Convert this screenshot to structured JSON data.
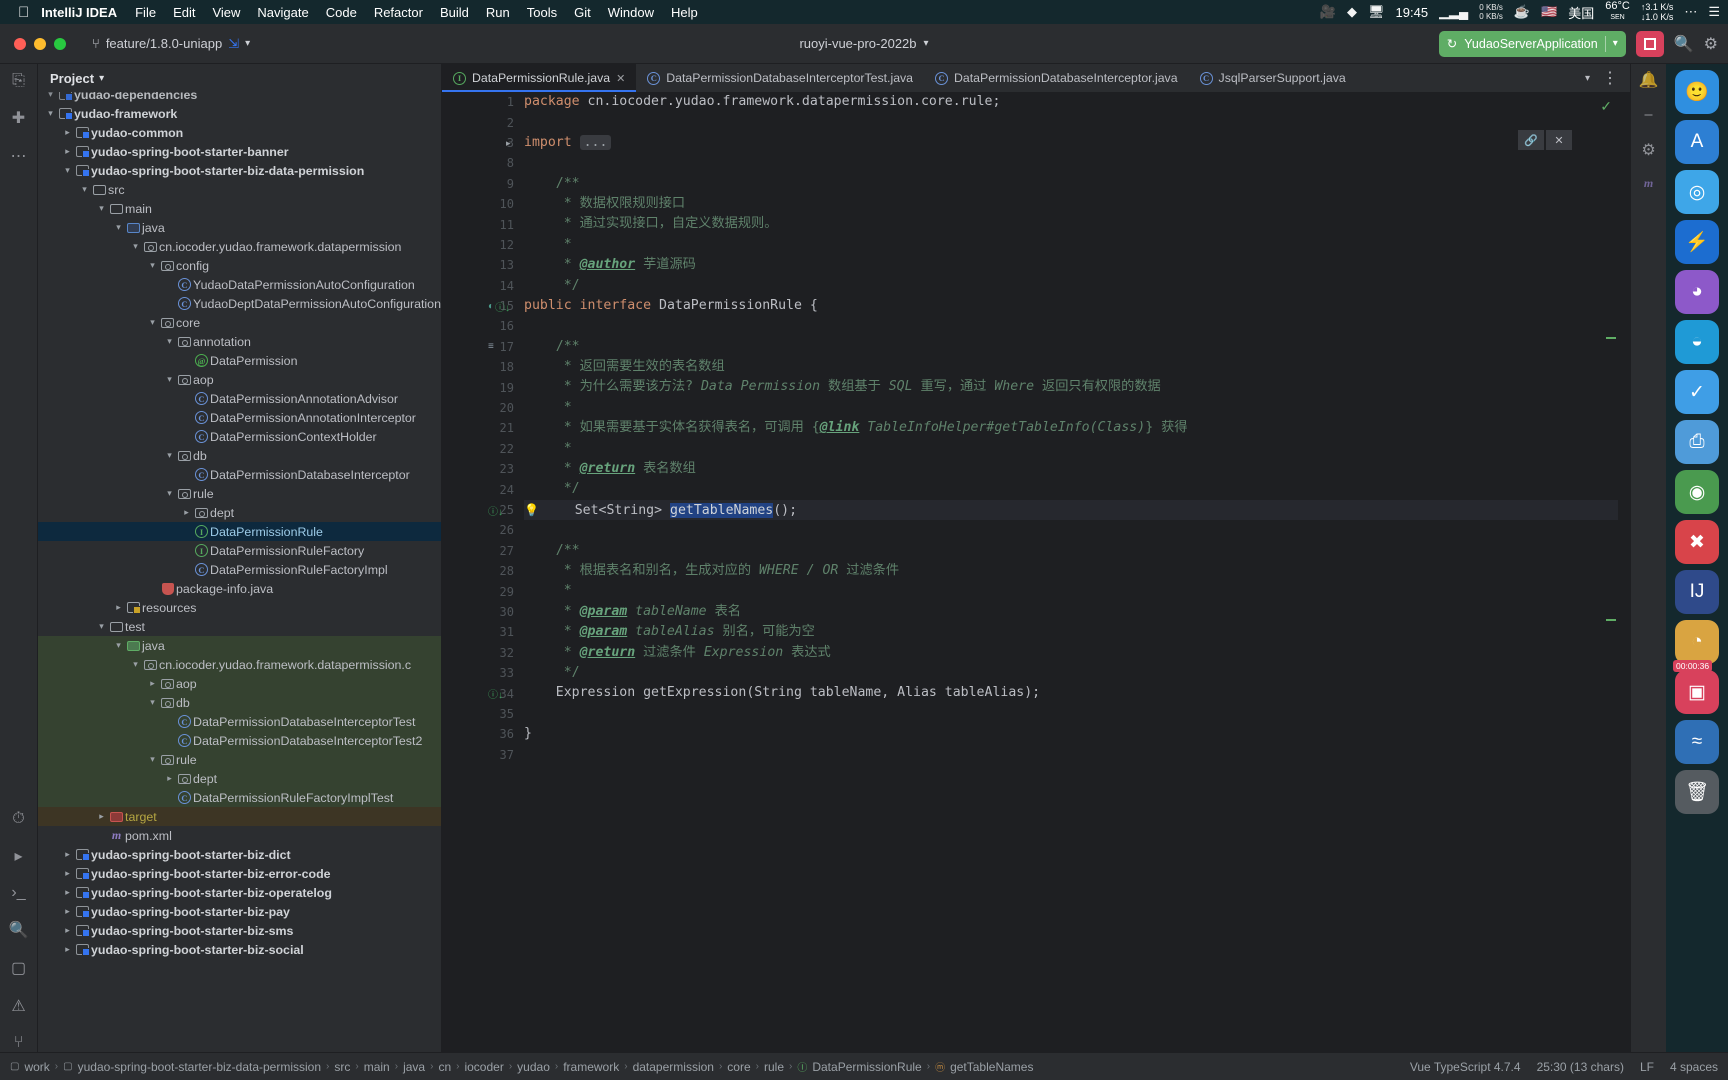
{
  "macbar": {
    "apple_icon": "apple-icon",
    "app_name": "IntelliJ IDEA",
    "menus": [
      "File",
      "Edit",
      "View",
      "Navigate",
      "Code",
      "Refactor",
      "Build",
      "Run",
      "Tools",
      "Git",
      "Window",
      "Help"
    ],
    "status": {
      "clock": "19:45",
      "net_up": "0 KB/s",
      "net_down": "0 KB/s",
      "input_source": "美国",
      "temperature": "66°C",
      "temperature_sub": "SEN",
      "speed_up": "3.1 K/s",
      "speed_down": "1.0 K/s"
    }
  },
  "titlebar": {
    "branch": "feature/1.8.0-uniapp",
    "project": "ruoyi-vue-pro-2022b",
    "run_config": "YudaoServerApplication",
    "stop_label": "stop-icon"
  },
  "project_panel": {
    "title": "Project",
    "tree": [
      {
        "depth": 1,
        "label": "yudao-dependencies",
        "arrow": "down",
        "icon": "module",
        "bold": true,
        "state": "clipped"
      },
      {
        "depth": 1,
        "label": "yudao-framework",
        "arrow": "down",
        "icon": "module",
        "bold": true
      },
      {
        "depth": 2,
        "label": "yudao-common",
        "arrow": "right",
        "icon": "module",
        "bold": true
      },
      {
        "depth": 2,
        "label": "yudao-spring-boot-starter-banner",
        "arrow": "right",
        "icon": "module",
        "bold": true
      },
      {
        "depth": 2,
        "label": "yudao-spring-boot-starter-biz-data-permission",
        "arrow": "down",
        "icon": "module",
        "bold": true
      },
      {
        "depth": 3,
        "label": "src",
        "arrow": "down",
        "icon": "folder"
      },
      {
        "depth": 4,
        "label": "main",
        "arrow": "down",
        "icon": "folder"
      },
      {
        "depth": 5,
        "label": "java",
        "arrow": "down",
        "icon": "folder-blue"
      },
      {
        "depth": 6,
        "label": "cn.iocoder.yudao.framework.datapermission",
        "arrow": "down",
        "icon": "package"
      },
      {
        "depth": 7,
        "label": "config",
        "arrow": "down",
        "icon": "package"
      },
      {
        "depth": 8,
        "label": "YudaoDataPermissionAutoConfiguration",
        "arrow": "none",
        "icon": "class"
      },
      {
        "depth": 8,
        "label": "YudaoDeptDataPermissionAutoConfiguration",
        "arrow": "none",
        "icon": "class"
      },
      {
        "depth": 7,
        "label": "core",
        "arrow": "down",
        "icon": "package"
      },
      {
        "depth": 8,
        "label": "annotation",
        "arrow": "down",
        "icon": "package"
      },
      {
        "depth": 9,
        "label": "DataPermission",
        "arrow": "none",
        "icon": "annotation"
      },
      {
        "depth": 8,
        "label": "aop",
        "arrow": "down",
        "icon": "package"
      },
      {
        "depth": 9,
        "label": "DataPermissionAnnotationAdvisor",
        "arrow": "none",
        "icon": "class"
      },
      {
        "depth": 9,
        "label": "DataPermissionAnnotationInterceptor",
        "arrow": "none",
        "icon": "class"
      },
      {
        "depth": 9,
        "label": "DataPermissionContextHolder",
        "arrow": "none",
        "icon": "class"
      },
      {
        "depth": 8,
        "label": "db",
        "arrow": "down",
        "icon": "package"
      },
      {
        "depth": 9,
        "label": "DataPermissionDatabaseInterceptor",
        "arrow": "none",
        "icon": "class"
      },
      {
        "depth": 8,
        "label": "rule",
        "arrow": "down",
        "icon": "package"
      },
      {
        "depth": 9,
        "label": "dept",
        "arrow": "right",
        "icon": "package"
      },
      {
        "depth": 9,
        "label": "DataPermissionRule",
        "arrow": "none",
        "icon": "interface",
        "selected": true
      },
      {
        "depth": 9,
        "label": "DataPermissionRuleFactory",
        "arrow": "none",
        "icon": "interface"
      },
      {
        "depth": 9,
        "label": "DataPermissionRuleFactoryImpl",
        "arrow": "none",
        "icon": "class"
      },
      {
        "depth": 7,
        "label": "package-info.java",
        "arrow": "none",
        "icon": "java"
      },
      {
        "depth": 5,
        "label": "resources",
        "arrow": "right",
        "icon": "resources"
      },
      {
        "depth": 4,
        "label": "test",
        "arrow": "down",
        "icon": "folder"
      },
      {
        "depth": 5,
        "label": "java",
        "arrow": "down",
        "icon": "folder-green",
        "testscope": true
      },
      {
        "depth": 6,
        "label": "cn.iocoder.yudao.framework.datapermission.c",
        "arrow": "down",
        "icon": "package",
        "testscope": true
      },
      {
        "depth": 7,
        "label": "aop",
        "arrow": "right",
        "icon": "package",
        "testscope": true
      },
      {
        "depth": 7,
        "label": "db",
        "arrow": "down",
        "icon": "package",
        "testscope": true
      },
      {
        "depth": 8,
        "label": "DataPermissionDatabaseInterceptorTest",
        "arrow": "none",
        "icon": "class",
        "testscope": true
      },
      {
        "depth": 8,
        "label": "DataPermissionDatabaseInterceptorTest2",
        "arrow": "none",
        "icon": "class",
        "testscope": true
      },
      {
        "depth": 7,
        "label": "rule",
        "arrow": "down",
        "icon": "package",
        "testscope": true
      },
      {
        "depth": 8,
        "label": "dept",
        "arrow": "right",
        "icon": "package",
        "testscope": true
      },
      {
        "depth": 8,
        "label": "DataPermissionRuleFactoryImplTest",
        "arrow": "none",
        "icon": "class",
        "testscope": true
      },
      {
        "depth": 4,
        "label": "target",
        "arrow": "right",
        "icon": "folder-red",
        "target": true
      },
      {
        "depth": 4,
        "label": "pom.xml",
        "arrow": "none",
        "icon": "maven"
      },
      {
        "depth": 2,
        "label": "yudao-spring-boot-starter-biz-dict",
        "arrow": "right",
        "icon": "module",
        "bold": true
      },
      {
        "depth": 2,
        "label": "yudao-spring-boot-starter-biz-error-code",
        "arrow": "right",
        "icon": "module",
        "bold": true
      },
      {
        "depth": 2,
        "label": "yudao-spring-boot-starter-biz-operatelog",
        "arrow": "right",
        "icon": "module",
        "bold": true
      },
      {
        "depth": 2,
        "label": "yudao-spring-boot-starter-biz-pay",
        "arrow": "right",
        "icon": "module",
        "bold": true
      },
      {
        "depth": 2,
        "label": "yudao-spring-boot-starter-biz-sms",
        "arrow": "right",
        "icon": "module",
        "bold": true
      },
      {
        "depth": 2,
        "label": "yudao-spring-boot-starter-biz-social",
        "arrow": "right",
        "icon": "module",
        "bold": true
      }
    ]
  },
  "editor": {
    "tabs": [
      {
        "label": "DataPermissionRule.java",
        "icon": "interface",
        "active": true,
        "closable": true
      },
      {
        "label": "DataPermissionDatabaseInterceptorTest.java",
        "icon": "class",
        "active": false
      },
      {
        "label": "DataPermissionDatabaseInterceptor.java",
        "icon": "class",
        "active": false
      },
      {
        "label": "JsqlParserSupport.java",
        "icon": "class",
        "active": false
      }
    ],
    "lines": [
      {
        "num": "1",
        "html": "<span class=\"kw\">package</span> <span class=\"plain\">cn.iocoder.yudao.framework.datapermission.core.rule;</span>"
      },
      {
        "num": "2",
        "html": ""
      },
      {
        "num": "3",
        "html": "<span class=\"kw\">import</span> <span class=\"import-fold\">...</span>",
        "fold": true
      },
      {
        "num": "8",
        "html": ""
      },
      {
        "num": "9",
        "html": "<span class=\"cmt\">    /**</span>"
      },
      {
        "num": "10",
        "html": "<span class=\"cmt\">     * 数据权限规则接口</span>"
      },
      {
        "num": "11",
        "html": "<span class=\"cmt\">     * 通过实现接口，自定义数据规则。</span>"
      },
      {
        "num": "12",
        "html": "<span class=\"cmt\">     *</span>"
      },
      {
        "num": "13",
        "html": "<span class=\"cmt\">     * </span><span class=\"doctag\">@author</span><span class=\"cmt\"> 芋道源码</span>"
      },
      {
        "num": "14",
        "html": "<span class=\"cmt\">     */</span>"
      },
      {
        "num": "15",
        "html": "<span class=\"kw\">public interface</span> <span class=\"plain\">DataPermissionRule {</span>",
        "gutter_icons": [
          "impl-icon",
          "override-icon"
        ]
      },
      {
        "num": "16",
        "html": ""
      },
      {
        "num": "17",
        "html": "<span class=\"cmt\">    /**</span>",
        "gutter_icons": [
          "doc-icon"
        ]
      },
      {
        "num": "18",
        "html": "<span class=\"cmt\">     * 返回需要生效的表名数组</span>"
      },
      {
        "num": "19",
        "html": "<span class=\"cmt\">     * 为什么需要该方法? </span><span class=\"cmtem\">Data Permission</span><span class=\"cmt\"> 数组基于 </span><span class=\"cmtem\">SQL</span><span class=\"cmt\"> 重写，通过 </span><span class=\"cmtem\">Where</span><span class=\"cmt\"> 返回只有权限的数据</span>"
      },
      {
        "num": "20",
        "html": "<span class=\"cmt\">     *</span>"
      },
      {
        "num": "21",
        "html": "<span class=\"cmt\">     * 如果需要基于实体名获得表名，可调用 {</span><span class=\"doctag\">@link</span><span class=\"cmtem\"> TableInfoHelper#getTableInfo(Class)</span><span class=\"cmt\">} 获得</span>"
      },
      {
        "num": "22",
        "html": "<span class=\"cmt\">     *</span>"
      },
      {
        "num": "23",
        "html": "<span class=\"cmt\">     * </span><span class=\"doctag\">@return</span><span class=\"cmt\"> 表名数组</span>"
      },
      {
        "num": "24",
        "html": "<span class=\"cmt\">     */</span>"
      },
      {
        "num": "25",
        "html": "<span class=\"plain\">    Set&lt;String&gt; </span><span class=\"sel-tok\">getTableNames</span><span class=\"plain\">();</span>",
        "gutter_icons": [
          "override-icon"
        ],
        "bulb": true,
        "current": true
      },
      {
        "num": "26",
        "html": ""
      },
      {
        "num": "27",
        "html": "<span class=\"cmt\">    /**</span>"
      },
      {
        "num": "28",
        "html": "<span class=\"cmt\">     * 根据表名和别名，生成对应的 </span><span class=\"cmtem\">WHERE / OR</span><span class=\"cmt\"> 过滤条件</span>"
      },
      {
        "num": "29",
        "html": "<span class=\"cmt\">     *</span>"
      },
      {
        "num": "30",
        "html": "<span class=\"cmt\">     * </span><span class=\"doctag\">@param</span><span class=\"cmtem\"> tableName</span><span class=\"cmt\"> 表名</span>"
      },
      {
        "num": "31",
        "html": "<span class=\"cmt\">     * </span><span class=\"doctag\">@param</span><span class=\"cmtem\"> tableAlias</span><span class=\"cmt\"> 别名，可能为空</span>"
      },
      {
        "num": "32",
        "html": "<span class=\"cmt\">     * </span><span class=\"doctag\">@return</span><span class=\"cmt\"> 过滤条件 </span><span class=\"cmtem\">Expression</span><span class=\"cmt\"> 表达式</span>"
      },
      {
        "num": "33",
        "html": "<span class=\"cmt\">     */</span>"
      },
      {
        "num": "34",
        "html": "<span class=\"plain\">    Expression </span><span class=\"meth\">getExpression</span><span class=\"plain\">(String tableName, Alias tableAlias);</span>",
        "gutter_icons": [
          "override-icon"
        ]
      },
      {
        "num": "35",
        "html": ""
      },
      {
        "num": "36",
        "html": "<span class=\"plain\">}</span>"
      },
      {
        "num": "37",
        "html": ""
      }
    ]
  },
  "statusbar": {
    "breadcrumb": [
      {
        "label": "work",
        "icon": "folder-icon"
      },
      {
        "label": "yudao-spring-boot-starter-biz-data-permission",
        "icon": "module-icon"
      },
      {
        "label": "src",
        "icon": ""
      },
      {
        "label": "main",
        "icon": ""
      },
      {
        "label": "java",
        "icon": ""
      },
      {
        "label": "cn",
        "icon": ""
      },
      {
        "label": "iocoder",
        "icon": ""
      },
      {
        "label": "yudao",
        "icon": ""
      },
      {
        "label": "framework",
        "icon": ""
      },
      {
        "label": "datapermission",
        "icon": ""
      },
      {
        "label": "core",
        "icon": ""
      },
      {
        "label": "rule",
        "icon": ""
      },
      {
        "label": "DataPermissionRule",
        "icon": "interface-icon"
      },
      {
        "label": "getTableNames",
        "icon": "method-icon"
      }
    ],
    "right": [
      {
        "label": "Vue TypeScript 4.7.4"
      },
      {
        "label": "25:30 (13 chars)"
      },
      {
        "label": "LF"
      },
      {
        "label": "4 spaces"
      }
    ]
  },
  "dock": {
    "items": [
      {
        "name": "finder-icon",
        "glyph": "🙂",
        "color": "#2f8fe0"
      },
      {
        "name": "appstore-icon",
        "glyph": "A",
        "color": "#2d7fd3"
      },
      {
        "name": "safari-icon",
        "glyph": "◎",
        "color": "#3ea6e8"
      },
      {
        "name": "thunder-icon",
        "glyph": "⚡",
        "color": "#1c6dd0"
      },
      {
        "name": "colors-icon",
        "glyph": "◕",
        "color": "#8d59c9"
      },
      {
        "name": "edge-icon",
        "glyph": "◒",
        "color": "#1f9ad6"
      },
      {
        "name": "todo-icon",
        "glyph": "✓",
        "color": "#3f9ee6"
      },
      {
        "name": "printer-icon",
        "glyph": "⎙",
        "color": "#4f9bd9"
      },
      {
        "name": "chrome-icon",
        "glyph": "◉",
        "color": "#4a9a4f"
      },
      {
        "name": "shuffle-icon",
        "glyph": "✖",
        "color": "#d8444a"
      },
      {
        "name": "intellij-icon",
        "glyph": "IJ",
        "color": "#2f4a8a"
      },
      {
        "name": "notes-icon",
        "glyph": "◔",
        "color": "#d9a441"
      },
      {
        "name": "recorder-icon",
        "glyph": "▣",
        "color": "#d8415c",
        "badge": "00:00:36"
      },
      {
        "name": "snake-icon",
        "glyph": "≈",
        "color": "#2f6fb5"
      },
      {
        "name": "trash-icon",
        "glyph": "🗑",
        "color": "#555b60"
      }
    ]
  }
}
